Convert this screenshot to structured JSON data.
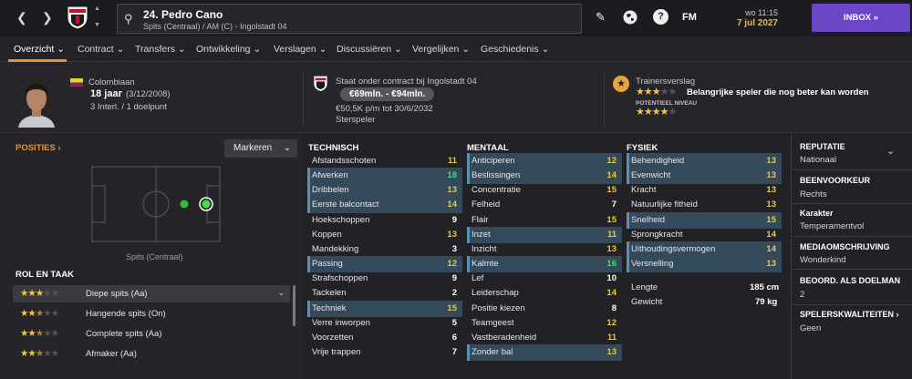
{
  "header": {
    "player_title": "24. Pedro Cano",
    "player_subtitle": "Spits (Centraal) / AM (C) - Ingolstadt 04",
    "fm_label": "FM",
    "time": "wo 11:15",
    "date": "7 jul 2027",
    "inbox_label": "INBOX",
    "help_label": "?"
  },
  "tabs": [
    {
      "label": "Overzicht",
      "active": true
    },
    {
      "label": "Contract"
    },
    {
      "label": "Transfers"
    },
    {
      "label": "Ontwikkeling"
    },
    {
      "label": "Verslagen"
    },
    {
      "label": "Discussiëren"
    },
    {
      "label": "Vergelijken"
    },
    {
      "label": "Geschiedenis"
    }
  ],
  "profile": {
    "nationality": "Colombiaan",
    "age": "18 jaar",
    "birthdate": "(3/12/2008)",
    "caps": "3 Interl. / 1 doelpunt",
    "contract_status": "Staat onder contract bij Ingolstadt 04",
    "value_range": "€69mln. - €94mln.",
    "wage": "€50,5K p/m tot 30/6/2032",
    "status": "Sterspeler",
    "scout_title": "Trainersverslag",
    "scout_verdict": "Belangrijke speler die nog beter kan worden",
    "potential_label": "POTENTIEEL NIVEAU",
    "current_stars": 3,
    "potential_stars": 4
  },
  "positions": {
    "heading": "POSITIES",
    "dropdown_label": "Markeren",
    "position_label": "Spits (Centraal)"
  },
  "roles": {
    "heading": "ROL EN TAAK",
    "items": [
      {
        "name": "Diepe spits (Aa)",
        "stars": 3,
        "selected": true
      },
      {
        "name": "Hangende spits (On)",
        "stars": 2.5
      },
      {
        "name": "Complete spits (Aa)",
        "stars": 2.5
      },
      {
        "name": "Afmaker (Aa)",
        "stars": 2.5
      }
    ]
  },
  "technical": {
    "heading": "TECHNISCH",
    "items": [
      {
        "name": "Afstandsschoten",
        "value": "11",
        "hl": false
      },
      {
        "name": "Afwerken",
        "value": "18",
        "hl": true
      },
      {
        "name": "Dribbelen",
        "value": "13",
        "hl": true
      },
      {
        "name": "Eerste balcontact",
        "value": "14",
        "hl": true
      },
      {
        "name": "Hoekschoppen",
        "value": "9",
        "hl": false
      },
      {
        "name": "Koppen",
        "value": "13",
        "hl": false
      },
      {
        "name": "Mandekking",
        "value": "3",
        "hl": false
      },
      {
        "name": "Passing",
        "value": "12",
        "hl": true
      },
      {
        "name": "Strafschoppen",
        "value": "9",
        "hl": false
      },
      {
        "name": "Tackelen",
        "value": "2",
        "hl": false
      },
      {
        "name": "Techniek",
        "value": "15",
        "hl": true
      },
      {
        "name": "Verre inworpen",
        "value": "5",
        "hl": false
      },
      {
        "name": "Voorzetten",
        "value": "6",
        "hl": false
      },
      {
        "name": "Vrije trappen",
        "value": "7",
        "hl": false
      }
    ]
  },
  "mental": {
    "heading": "MENTAAL",
    "items": [
      {
        "name": "Anticiperen",
        "value": "12",
        "hl": true
      },
      {
        "name": "Beslissingen",
        "value": "14",
        "hl": true
      },
      {
        "name": "Concentratie",
        "value": "15",
        "hl": false
      },
      {
        "name": "Felheid",
        "value": "7",
        "hl": false
      },
      {
        "name": "Flair",
        "value": "15",
        "hl": false
      },
      {
        "name": "Inzet",
        "value": "11",
        "hl": true
      },
      {
        "name": "Inzicht",
        "value": "13",
        "hl": false
      },
      {
        "name": "Kalmte",
        "value": "16",
        "hl": true
      },
      {
        "name": "Lef",
        "value": "10",
        "hl": false
      },
      {
        "name": "Leiderschap",
        "value": "14",
        "hl": false
      },
      {
        "name": "Positie kiezen",
        "value": "8",
        "hl": false
      },
      {
        "name": "Teamgeest",
        "value": "12",
        "hl": false
      },
      {
        "name": "Vastberadenheid",
        "value": "11",
        "hl": false
      },
      {
        "name": "Zonder bal",
        "value": "13",
        "hl": true
      }
    ]
  },
  "physical": {
    "heading": "FYSIEK",
    "items": [
      {
        "name": "Behendigheid",
        "value": "13",
        "hl": true
      },
      {
        "name": "Evenwicht",
        "value": "13",
        "hl": true
      },
      {
        "name": "Kracht",
        "value": "13",
        "hl": false
      },
      {
        "name": "Natuurlijke fitheid",
        "value": "13",
        "hl": false
      },
      {
        "name": "Snelheid",
        "value": "15",
        "hl": true
      },
      {
        "name": "Sprongkracht",
        "value": "14",
        "hl": false
      },
      {
        "name": "Uithoudingsvermogen",
        "value": "14",
        "hl": true
      },
      {
        "name": "Versnelling",
        "value": "13",
        "hl": true
      }
    ],
    "length_label": "Lengte",
    "length_value": "185 cm",
    "weight_label": "Gewicht",
    "weight_value": "79 kg"
  },
  "info": [
    {
      "heading": "REPUTATIE",
      "value": "Nationaal"
    },
    {
      "heading": "BEENVOORKEUR",
      "value": "Rechts"
    },
    {
      "heading": "Karakter",
      "value": "Temperamentvol"
    },
    {
      "heading": "MEDIAOMSCHRIJVING",
      "value": "Wonderkind"
    },
    {
      "heading": "BEOORD. ALS DOELMAN",
      "value": "2"
    },
    {
      "heading": "SPELERSKWALITEITEN",
      "value": "Geen"
    }
  ],
  "colors": {
    "accent": "#e8903a",
    "inbox": "#6b47c8",
    "attr_green": "#3fe06a",
    "attr_yellow": "#e9c93d",
    "highlight_row": "#34495a"
  }
}
